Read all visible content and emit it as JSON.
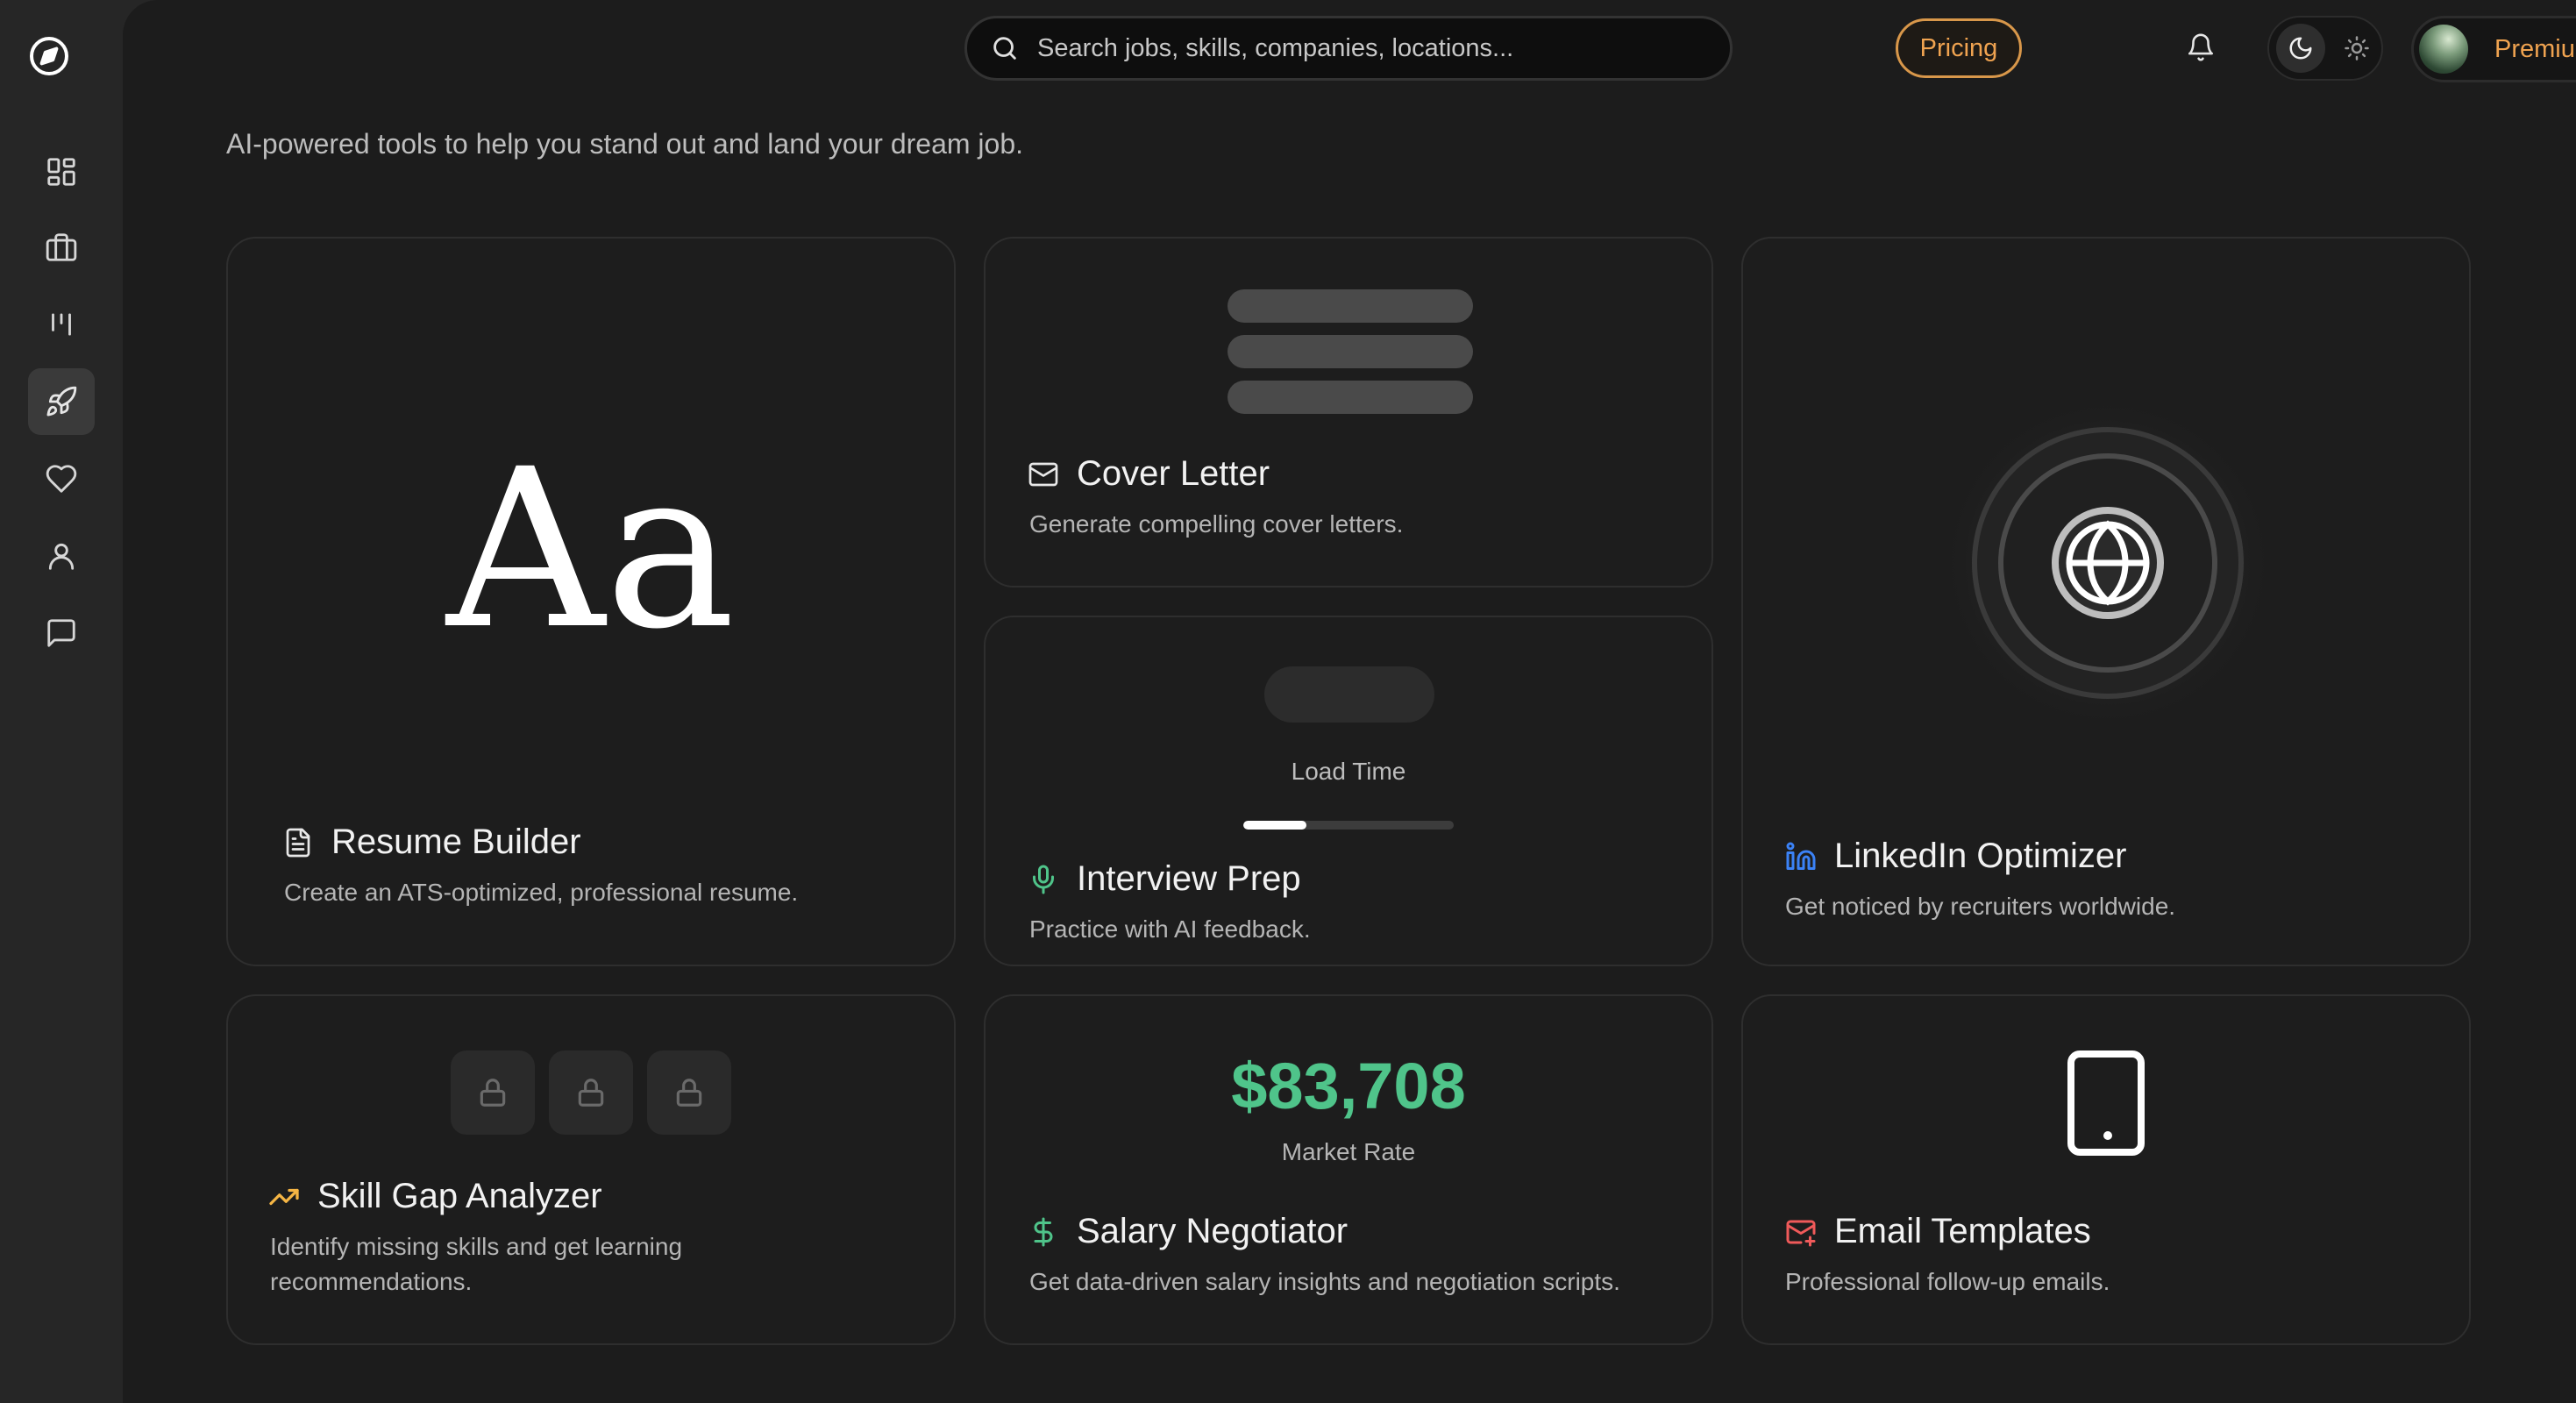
{
  "search": {
    "placeholder": "Search jobs, skills, companies, locations..."
  },
  "header": {
    "pricing_label": "Pricing",
    "premium_label": "Premium"
  },
  "page": {
    "subtitle": "AI-powered tools to help you stand out and land your dream job."
  },
  "sidebar": {
    "items": [
      {
        "name": "dashboard",
        "icon": "dashboard-icon"
      },
      {
        "name": "jobs",
        "icon": "briefcase-icon"
      },
      {
        "name": "board",
        "icon": "kanban-icon"
      },
      {
        "name": "career-tools",
        "icon": "rocket-icon",
        "active": true
      },
      {
        "name": "saved",
        "icon": "heart-icon"
      },
      {
        "name": "profile",
        "icon": "user-icon"
      },
      {
        "name": "messages",
        "icon": "chat-icon"
      }
    ]
  },
  "tools": {
    "resume": {
      "title": "Resume Builder",
      "desc": "Create an ATS-optimized, professional resume.",
      "glyph": "Aa",
      "icon": "document-icon"
    },
    "cover_letter": {
      "title": "Cover Letter",
      "desc": "Generate compelling cover letters.",
      "icon": "mail-icon"
    },
    "interview": {
      "title": "Interview Prep",
      "desc": "Practice with AI feedback.",
      "icon": "microphone-icon",
      "load_label": "Load Time",
      "progress": 0.3
    },
    "linkedin": {
      "title": "LinkedIn Optimizer",
      "desc": "Get noticed by recruiters worldwide.",
      "icon": "linkedin-icon"
    },
    "skill_gap": {
      "title": "Skill Gap Analyzer",
      "desc": "Identify missing skills and get learning recommendations.",
      "icon": "trending-up-icon"
    },
    "salary": {
      "title": "Salary Negotiator",
      "desc": "Get data-driven salary insights and negotiation scripts.",
      "icon": "dollar-icon",
      "amount": "$83,708",
      "amount_label": "Market Rate"
    },
    "email": {
      "title": "Email Templates",
      "desc": "Professional follow-up emails.",
      "icon": "mail-plus-icon"
    }
  },
  "colors": {
    "accent_orange": "#f0a350",
    "salary_green": "#4fc48a",
    "linkedin_blue": "#3b82f6",
    "skill_amber": "#f5b544",
    "email_red": "#f05a5a",
    "mic_green": "#4fc48a"
  }
}
